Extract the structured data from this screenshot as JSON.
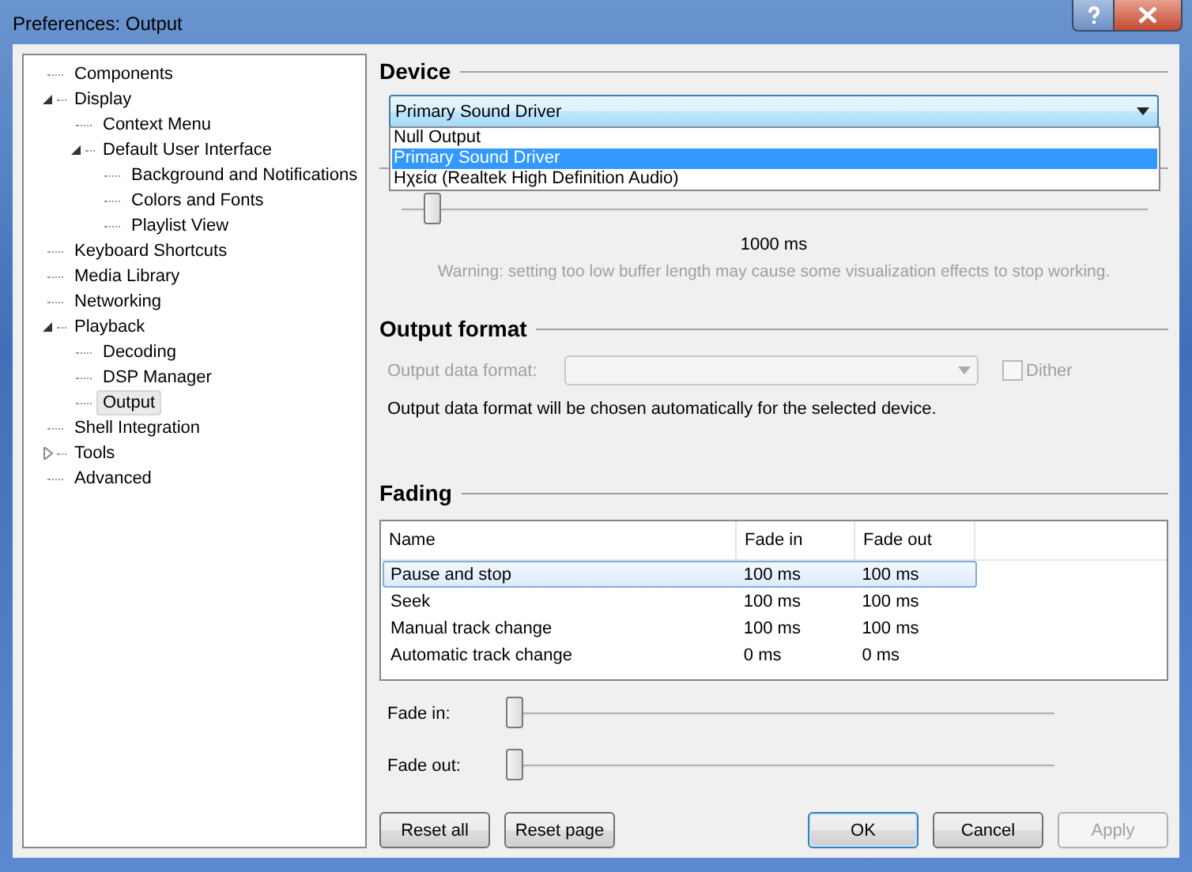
{
  "window": {
    "title": "Preferences: Output"
  },
  "tree": [
    {
      "label": "Components",
      "selected": false
    },
    {
      "label": "Display",
      "selected": false,
      "expanded": true,
      "children": [
        {
          "label": "Context Menu",
          "selected": false
        },
        {
          "label": "Default User Interface",
          "selected": false,
          "expanded": true,
          "children": [
            {
              "label": "Background and Notifications",
              "selected": false
            },
            {
              "label": "Colors and Fonts",
              "selected": false
            },
            {
              "label": "Playlist View",
              "selected": false
            }
          ]
        }
      ]
    },
    {
      "label": "Keyboard Shortcuts",
      "selected": false
    },
    {
      "label": "Media Library",
      "selected": false
    },
    {
      "label": "Networking",
      "selected": false
    },
    {
      "label": "Playback",
      "selected": false,
      "expanded": true,
      "children": [
        {
          "label": "Decoding",
          "selected": false
        },
        {
          "label": "DSP Manager",
          "selected": false
        },
        {
          "label": "Output",
          "selected": true
        }
      ]
    },
    {
      "label": "Shell Integration",
      "selected": false
    },
    {
      "label": "Tools",
      "selected": false,
      "expanded": false
    },
    {
      "label": "Advanced",
      "selected": false
    }
  ],
  "device": {
    "heading": "Device",
    "value": "Primary Sound Driver",
    "options": [
      {
        "label": "Null Output",
        "selected": false
      },
      {
        "label": "Primary Sound Driver",
        "selected": true
      },
      {
        "label": "Ηχεία (Realtek High Definition Audio)",
        "selected": false
      }
    ]
  },
  "buffer": {
    "level": 0.03,
    "reading": "1000 ms",
    "warning": "Warning: setting too low buffer length may cause some visualization effects to stop working."
  },
  "output_format": {
    "heading": "Output format",
    "format_label": "Output data format:",
    "disabled": true,
    "dither": {
      "label": "Dither",
      "checked": false
    },
    "note": "Output data format will be chosen automatically for the selected device."
  },
  "fading": {
    "heading": "Fading",
    "columns": [
      "Name",
      "Fade in",
      "Fade out"
    ],
    "rows": [
      {
        "cells": [
          "Pause and stop",
          "100 ms",
          "100 ms"
        ],
        "selected": true
      },
      {
        "cells": [
          "Seek",
          "100 ms",
          "100 ms"
        ],
        "selected": false
      },
      {
        "cells": [
          "Manual track change",
          "100 ms",
          "100 ms"
        ],
        "selected": false
      },
      {
        "cells": [
          "Automatic track change",
          "0 ms",
          "0 ms"
        ],
        "selected": false
      }
    ],
    "sliders": [
      {
        "label": "Fade in:",
        "level": 0
      },
      {
        "label": "Fade out:",
        "level": 0
      }
    ]
  },
  "buttons_left": [
    {
      "label": "Reset all",
      "default": false,
      "disabled": false
    },
    {
      "label": "Reset page",
      "default": false,
      "disabled": false
    }
  ],
  "buttons_right": [
    {
      "label": "OK",
      "default": true,
      "disabled": false
    },
    {
      "label": "Cancel",
      "default": false,
      "disabled": false
    },
    {
      "label": "Apply",
      "default": false,
      "disabled": true
    }
  ]
}
